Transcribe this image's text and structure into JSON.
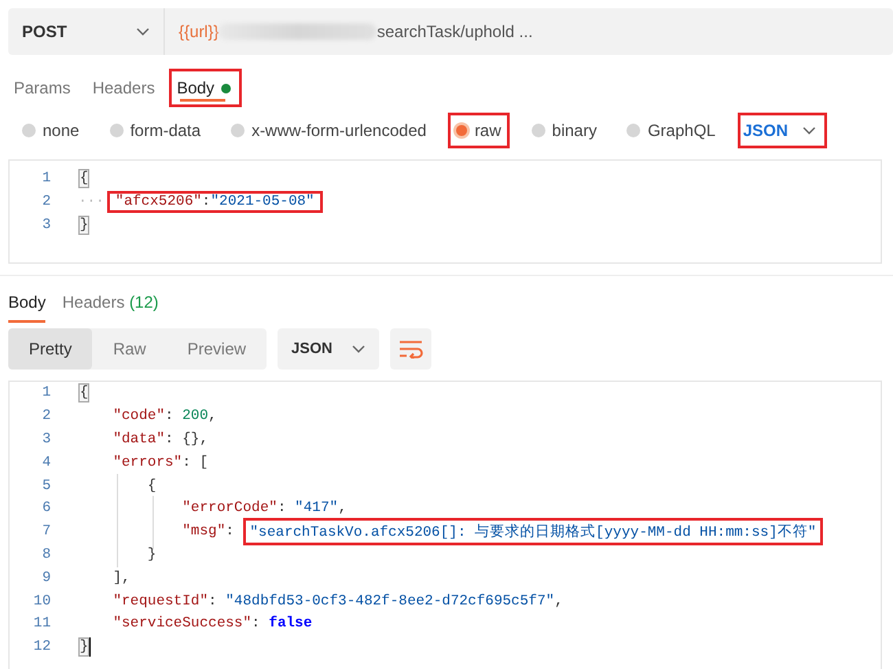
{
  "request": {
    "method": "POST",
    "url_variable": "{{url}}",
    "url_path": "searchTask/uphold ..."
  },
  "request_tabs": [
    {
      "label": "Params",
      "selected": false,
      "indicator": false,
      "highlighted": false
    },
    {
      "label": "Headers",
      "selected": false,
      "indicator": false,
      "highlighted": false
    },
    {
      "label": "Body",
      "selected": true,
      "indicator": true,
      "highlighted": true
    }
  ],
  "body_types": [
    {
      "label": "none",
      "selected": false,
      "highlighted": false
    },
    {
      "label": "form-data",
      "selected": false,
      "highlighted": false
    },
    {
      "label": "x-www-form-urlencoded",
      "selected": false,
      "highlighted": false
    },
    {
      "label": "raw",
      "selected": true,
      "highlighted": true
    },
    {
      "label": "binary",
      "selected": false,
      "highlighted": false
    },
    {
      "label": "GraphQL",
      "selected": false,
      "highlighted": false
    }
  ],
  "body_language": {
    "label": "JSON",
    "highlighted": true
  },
  "request_body": [
    {
      "number": "1",
      "highlighted": false,
      "tokens": [
        {
          "bracket": "{"
        }
      ]
    },
    {
      "number": "2",
      "highlighted": true,
      "tokens": [
        {
          "whitespace": "···"
        },
        {
          "key": "\"afcx5206\""
        },
        {
          "punct": ":"
        },
        {
          "string": "\"2021-05-08\""
        }
      ]
    },
    {
      "number": "3",
      "highlighted": false,
      "tokens": [
        {
          "bracket": "}"
        }
      ]
    }
  ],
  "response_tabs": [
    {
      "label": "Body",
      "selected": true
    },
    {
      "label": "Headers",
      "count": "(12)",
      "selected": false
    }
  ],
  "view_modes": [
    {
      "label": "Pretty",
      "selected": true
    },
    {
      "label": "Raw",
      "selected": false
    },
    {
      "label": "Preview",
      "selected": false
    }
  ],
  "response_format": "JSON",
  "response_body": [
    {
      "number": "1",
      "tokens": [
        {
          "bracket": "{"
        }
      ]
    },
    {
      "number": "2",
      "tokens": [
        {
          "key": "    \"code\""
        },
        {
          "punct": ": "
        },
        {
          "number": "200"
        },
        {
          "punct": ","
        }
      ]
    },
    {
      "number": "3",
      "tokens": [
        {
          "key": "    \"data\""
        },
        {
          "punct": ": {},"
        }
      ]
    },
    {
      "number": "4",
      "tokens": [
        {
          "key": "    \"errors\""
        },
        {
          "punct": ": ["
        }
      ]
    },
    {
      "number": "5",
      "tokens": [
        {
          "punct": "        {"
        }
      ]
    },
    {
      "number": "6",
      "tokens": [
        {
          "key": "            \"errorCode\""
        },
        {
          "punct": ": "
        },
        {
          "string": "\"417\""
        },
        {
          "punct": ","
        }
      ]
    },
    {
      "number": "7",
      "tokens": [
        {
          "key": "            \"msg\""
        },
        {
          "punct": ": "
        },
        {
          "string": "\"searchTaskVo.afcx5206[]: 与要求的日期格式[yyyy-MM-dd HH:mm:ss]不符\"",
          "highlighted": true
        }
      ]
    },
    {
      "number": "8",
      "tokens": [
        {
          "punct": "        }"
        }
      ]
    },
    {
      "number": "9",
      "tokens": [
        {
          "punct": "    ],"
        }
      ]
    },
    {
      "number": "10",
      "tokens": [
        {
          "key": "    \"requestId\""
        },
        {
          "punct": ": "
        },
        {
          "string": "\"48dbfd53-0cf3-482f-8ee2-d72cf695c5f7\""
        },
        {
          "punct": ","
        }
      ]
    },
    {
      "number": "11",
      "tokens": [
        {
          "key": "    \"serviceSuccess\""
        },
        {
          "punct": ": "
        },
        {
          "bool": "false"
        }
      ]
    },
    {
      "number": "12",
      "tokens": [
        {
          "bracket": "}"
        }
      ]
    }
  ]
}
